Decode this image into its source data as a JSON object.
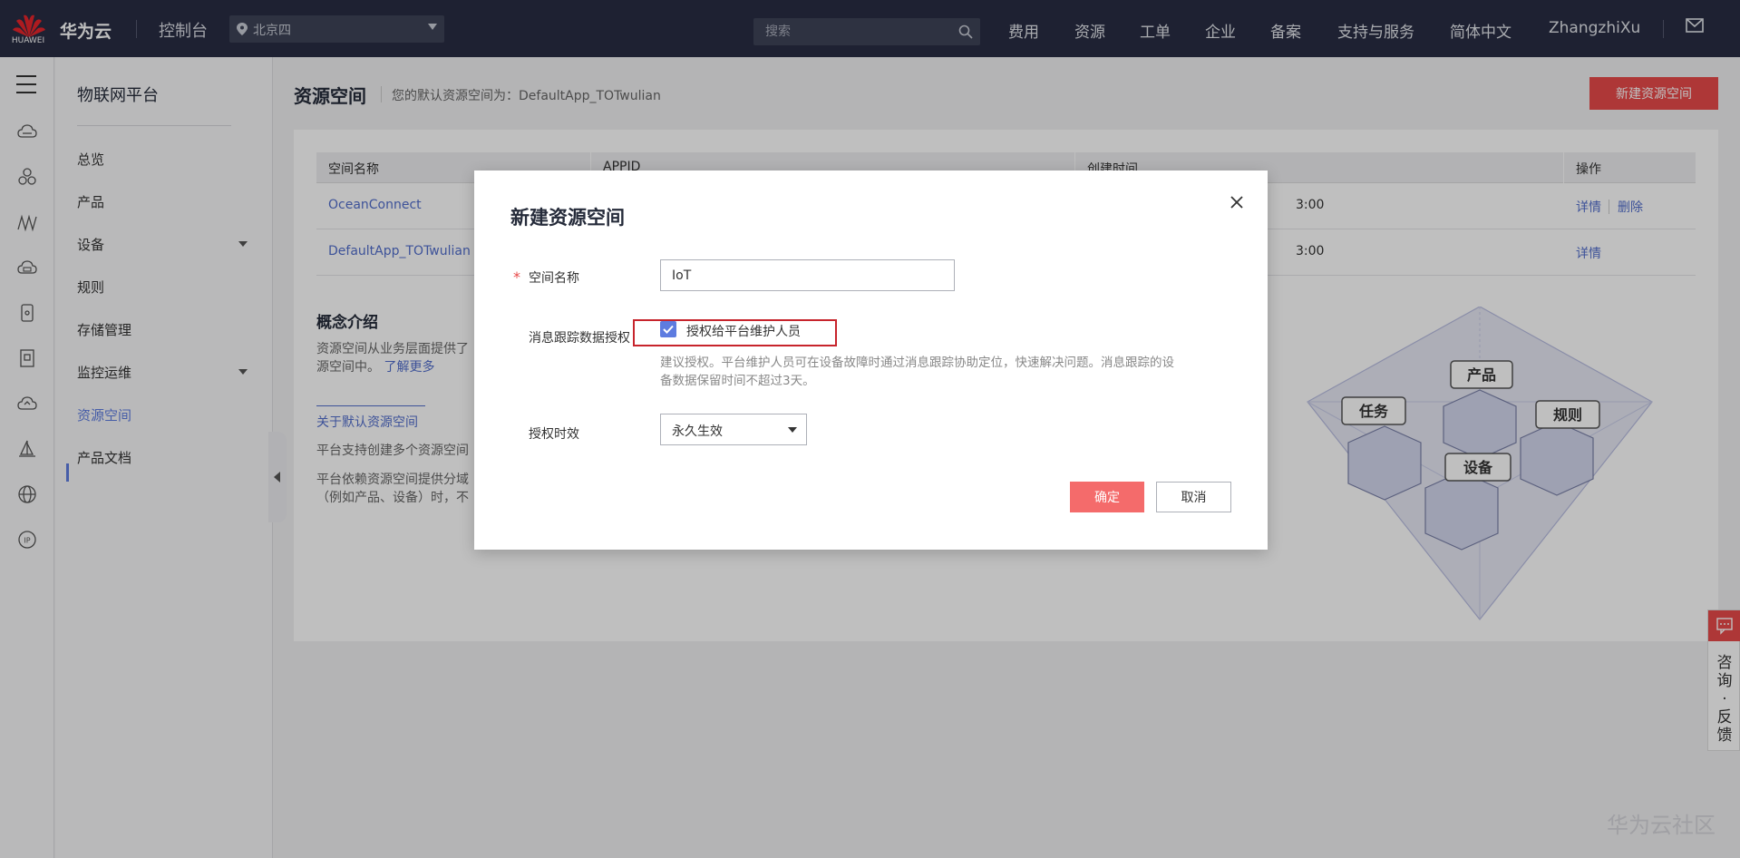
{
  "topbar": {
    "logo_text": "HUAWEI",
    "brand": "华为云",
    "console": "控制台",
    "region": "北京四",
    "search_placeholder": "搜索",
    "nav": [
      "费用",
      "资源",
      "工单",
      "企业",
      "备案",
      "支持与服务",
      "简体中文",
      "ZhangzhiXu"
    ]
  },
  "menu": {
    "title": "物联网平台",
    "items": [
      {
        "label": "总览"
      },
      {
        "label": "产品"
      },
      {
        "label": "设备"
      },
      {
        "label": "规则"
      },
      {
        "label": "存储管理"
      },
      {
        "label": "监控运维"
      },
      {
        "label": "资源空间"
      },
      {
        "label": "产品文档"
      }
    ]
  },
  "main": {
    "title": "资源空间",
    "default_text": "您的默认资源空间为：DefaultApp_TOTwulian",
    "new_button": "新建资源空间",
    "table": {
      "headers": [
        "空间名称",
        "APPID",
        "创建时间",
        "操作"
      ],
      "rows": [
        {
          "name": "OceanConnect",
          "time": "3:00",
          "ops": [
            "详情",
            "删除"
          ]
        },
        {
          "name": "DefaultApp_TOTwulian",
          "time": "3:00",
          "ops": [
            "详情"
          ]
        }
      ]
    },
    "concept": {
      "title": "概念介绍",
      "line1": "资源空间从业务层面提供了",
      "line2": "源空间中。",
      "learn_more": "了解更多",
      "about_link": "关于默认资源空间",
      "p1": "平台支持创建多个资源空间",
      "p2": "平台依赖资源空间提供分域",
      "p3": "（例如产品、设备）时，不"
    },
    "illustration": {
      "labels": [
        "产品",
        "任务",
        "规则",
        "设备"
      ]
    }
  },
  "dialog": {
    "title": "新建资源空间",
    "name_label": "空间名称",
    "name_value": "IoT",
    "trace_label": "消息跟踪数据授权",
    "checkbox_label": "授权给平台维护人员",
    "checkbox_checked": true,
    "hint_line1": "建议授权。平台维护人员可在设备故障时通过消息跟踪协助定位，快速解决问题。消息跟踪的设",
    "hint_line2": "备数据保留时间不超过3天。",
    "validity_label": "授权时效",
    "validity_value": "永久生效",
    "ok": "确定",
    "cancel": "取消"
  },
  "feedback": {
    "text": "咨询·反馈"
  },
  "watermark": "华为云社区",
  "colors": {
    "topbar_bg": "#282d43",
    "accent_red": "#e84a4a",
    "link_blue": "#526ecc",
    "checkbox_blue": "#5e7ce0",
    "highlight_box": "#c7242c"
  }
}
